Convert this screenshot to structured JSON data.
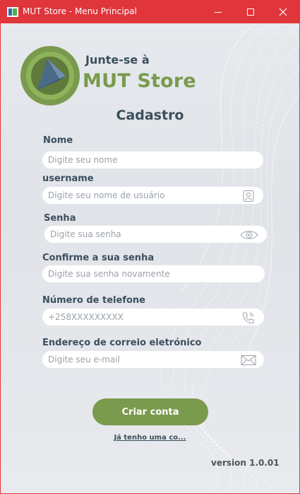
{
  "window": {
    "title": "MUT Store - Menu Principal"
  },
  "branding": {
    "tagline": "Junte-se à",
    "brand": "MUT Store"
  },
  "form": {
    "title": "Cadastro",
    "fields": [
      {
        "label": "Nome",
        "placeholder": "Digite seu nome",
        "value": "",
        "icon": "none"
      },
      {
        "label": "username",
        "placeholder": "Digite seu nome de usuário",
        "value": "",
        "icon": "user-icon"
      },
      {
        "label": "Senha",
        "placeholder": "Digite sua senha",
        "value": "",
        "icon": "eye-icon"
      },
      {
        "label": "Confirme a sua senha",
        "placeholder": "Digite sua senha novamente",
        "value": "",
        "icon": "none"
      },
      {
        "label": "Número de telefone",
        "placeholder": "+258XXXXXXXXX",
        "value": "",
        "icon": "phone-icon"
      },
      {
        "label": "Endereço de correio eletrónico",
        "placeholder": "Digite seu e-mail",
        "value": "",
        "icon": "mail-icon"
      }
    ],
    "submit_label": "Criar conta",
    "login_link": "Já tenho uma co..."
  },
  "footer": {
    "version": "version 1.0.01"
  },
  "colors": {
    "titlebar": "#e0353b",
    "accent": "#7a9a4e",
    "heading": "#3b4f5c"
  }
}
